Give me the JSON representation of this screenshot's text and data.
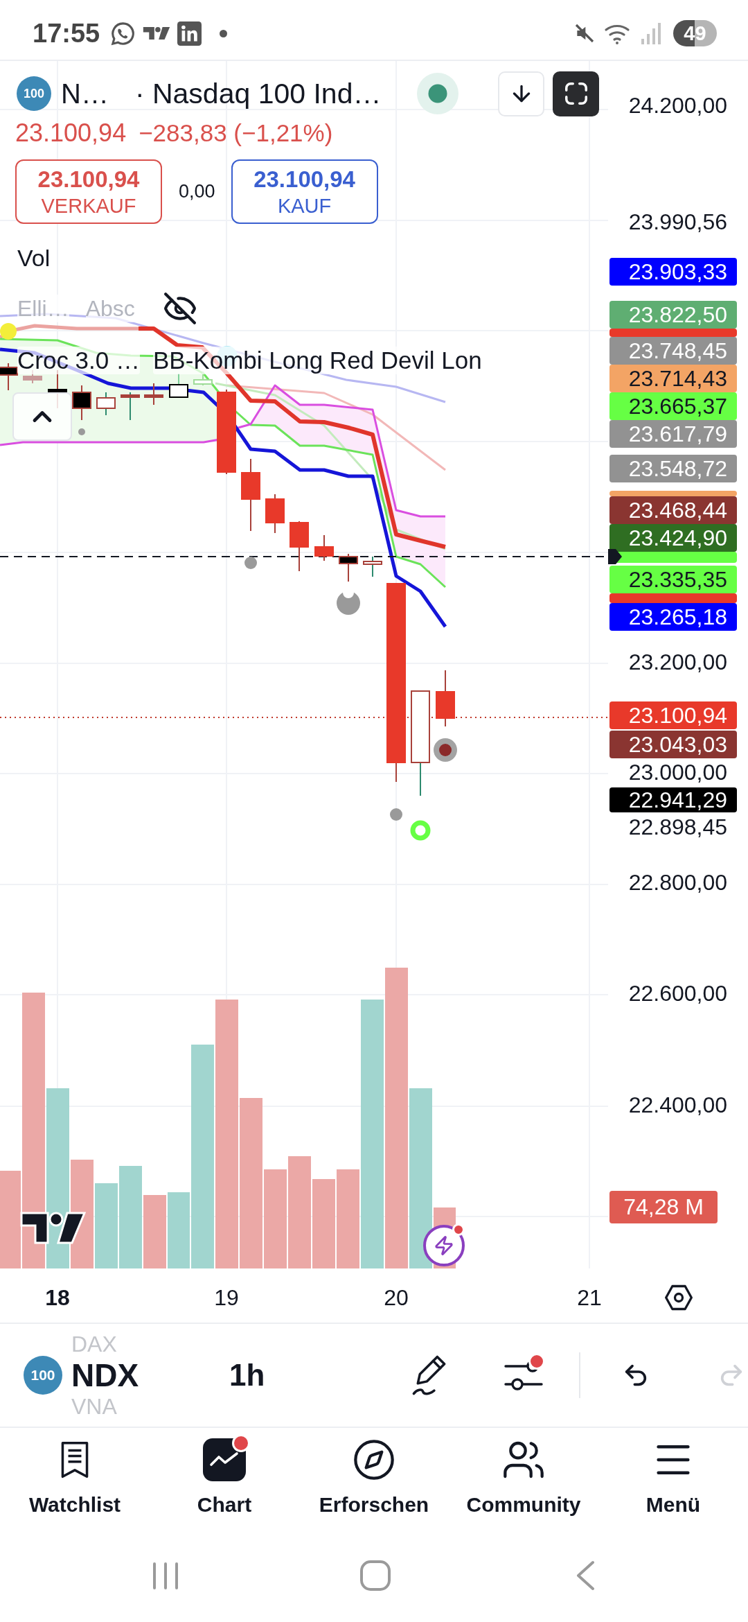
{
  "status_bar": {
    "time": "17:55",
    "battery": "49"
  },
  "symbol_header": {
    "logo_text": "100",
    "short_name": "N…",
    "full_name": "· Nasdaq 100 Ind…"
  },
  "quote": {
    "last": "23.100,94",
    "change": "−283,83 (−1,21%)"
  },
  "trade": {
    "sell_price": "23.100,94",
    "sell_label": "VERKAUF",
    "spread": "0,00",
    "buy_price": "23.100,94",
    "buy_label": "KAUF"
  },
  "legends": {
    "volume": "Vol",
    "indicators": [
      {
        "name": "Elli…",
        "hidden": true
      },
      {
        "name": "Absc",
        "hidden": true
      },
      {
        "name": "Croc 3.0 …",
        "hidden": false
      },
      {
        "name": "BB-Kombi Long Red Devil Lon",
        "hidden": false
      }
    ]
  },
  "price_axis": [
    {
      "kind": "tick",
      "text": "24.200,00"
    },
    {
      "kind": "tick",
      "text": "23.990,56"
    },
    {
      "kind": "tag",
      "text": "23.903,33",
      "color": "#0000ff"
    },
    {
      "kind": "tag",
      "text": "23.822,50",
      "color": "#5fae72"
    },
    {
      "kind": "strip",
      "color": "#e8392a"
    },
    {
      "kind": "tag",
      "text": "23.748,45",
      "color": "#929292"
    },
    {
      "kind": "tag",
      "text": "23.714,43",
      "color": "#f3a465"
    },
    {
      "kind": "tag",
      "text": "23.665,37",
      "color": "#66ff44"
    },
    {
      "kind": "tag",
      "text": "23.617,79",
      "color": "#929292"
    },
    {
      "kind": "tag",
      "text": "23.548,72",
      "color": "#929292"
    },
    {
      "kind": "strip",
      "color": "#f3a465"
    },
    {
      "kind": "tag",
      "text": "23.468,44",
      "color": "#8a3531"
    },
    {
      "kind": "tag",
      "text": "23.424,90",
      "color": "#2f6e22"
    },
    {
      "kind": "strip",
      "color": "#66ff44"
    },
    {
      "kind": "tag",
      "text": "23.335,35",
      "color": "#66ff44"
    },
    {
      "kind": "strip",
      "color": "#e8392a"
    },
    {
      "kind": "tag",
      "text": "23.265,18",
      "color": "#0000ff"
    },
    {
      "kind": "tick",
      "text": "23.200,00"
    },
    {
      "kind": "tag",
      "text": "23.100,94",
      "color": "#e8392a"
    },
    {
      "kind": "tag",
      "text": "23.043,03",
      "color": "#8a3531"
    },
    {
      "kind": "tick",
      "text": "23.000,00"
    },
    {
      "kind": "tag",
      "text": "22.941,29",
      "color": "#000000"
    },
    {
      "kind": "tag",
      "text": "22.898,45",
      "color": "#ffffff"
    },
    {
      "kind": "tick",
      "text": "22.800,00"
    },
    {
      "kind": "tick",
      "text": "22.600,00"
    },
    {
      "kind": "tick",
      "text": "22.400,00"
    }
  ],
  "volume_reading": "74,28 M",
  "time_axis": [
    {
      "label": "18",
      "major": true
    },
    {
      "label": "19",
      "major": false
    },
    {
      "label": "20",
      "major": false
    },
    {
      "label": "21",
      "major": false
    }
  ],
  "toolbar": {
    "logo_text": "100",
    "symbols": [
      {
        "text": "DAX",
        "selected": false
      },
      {
        "text": "NDX",
        "selected": true
      },
      {
        "text": "VNA",
        "selected": false
      }
    ],
    "interval": "1h",
    "settings_badge": true,
    "redo_disabled": true
  },
  "bottom_nav": [
    {
      "label": "Watchlist",
      "kind": "watchlist",
      "selected": false,
      "badge": false
    },
    {
      "label": "Chart",
      "kind": "chart",
      "selected": true,
      "badge": true
    },
    {
      "label": "Erforschen",
      "kind": "explore",
      "selected": false,
      "badge": false
    },
    {
      "label": "Community",
      "kind": "community",
      "selected": false,
      "badge": false
    },
    {
      "label": "Menü",
      "kind": "menu",
      "selected": false,
      "badge": false
    }
  ]
}
